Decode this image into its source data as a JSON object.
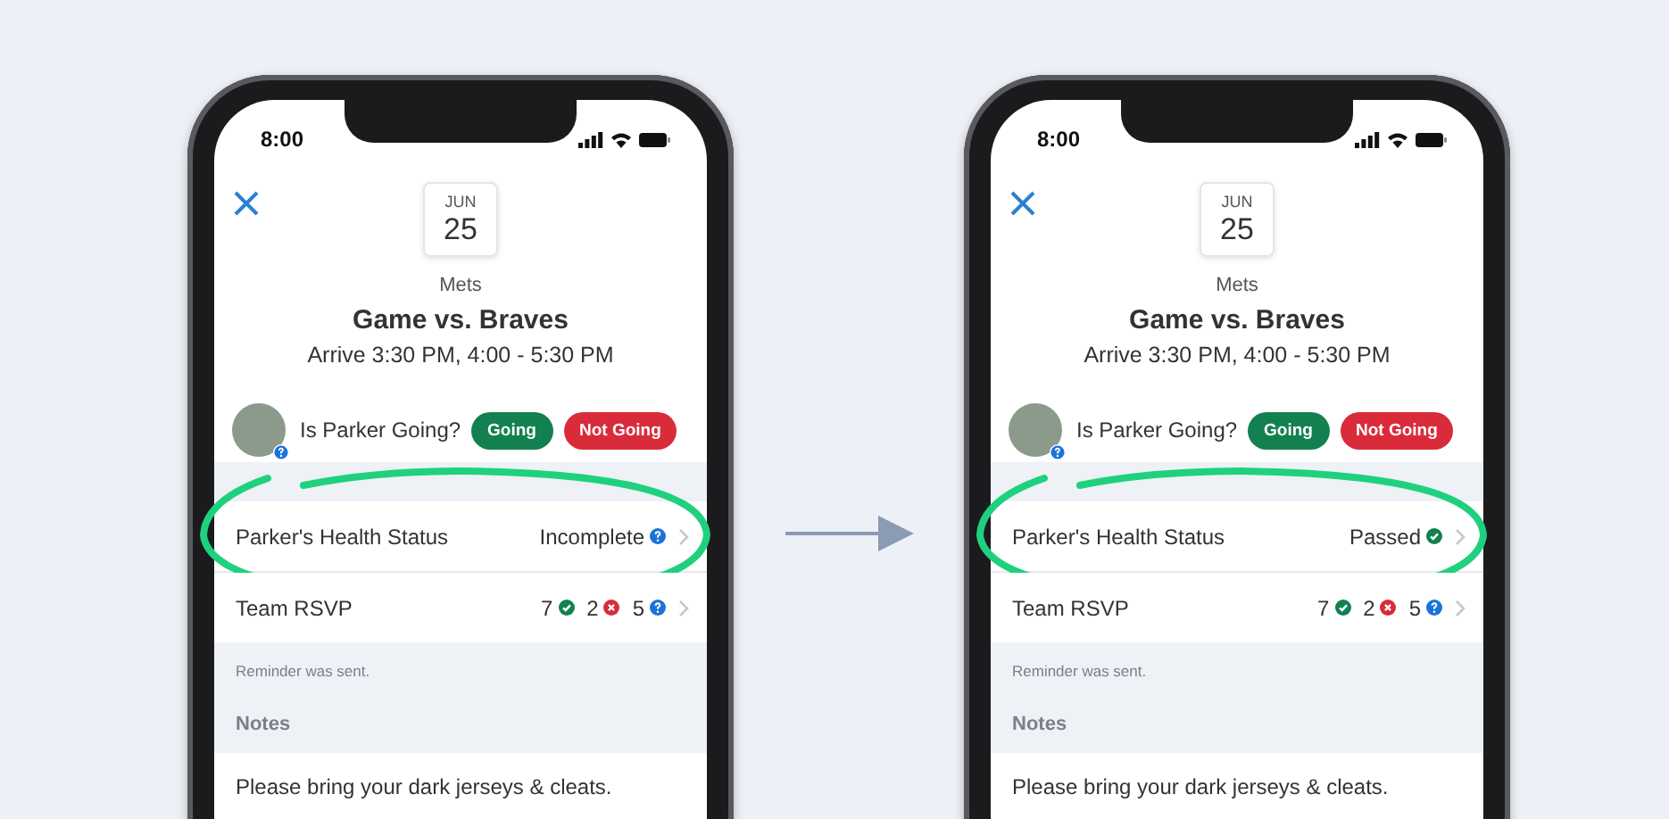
{
  "phones": [
    {
      "status_time": "8:00",
      "date": {
        "month": "JUN",
        "day": "25"
      },
      "team": "Mets",
      "title": "Game vs. Braves",
      "time": "Arrive 3:30 PM, 4:00 - 5:30 PM",
      "question": "Is Parker Going?",
      "buttons": [
        {
          "label": "Going",
          "kind": "going"
        },
        {
          "label": "Not Going",
          "kind": "not_going"
        }
      ],
      "health": {
        "label": "Parker's Health Status",
        "value": "Incomplete",
        "kind": "incomplete"
      },
      "rsvp": {
        "label": "Team RSVP",
        "counts": [
          {
            "value": "7",
            "kind": "yes"
          },
          {
            "value": "2",
            "kind": "no"
          },
          {
            "value": "5",
            "kind": "unknown"
          }
        ]
      },
      "reminder": "Reminder was sent.",
      "notes_heading": "Notes",
      "notes": "Please bring your dark jerseys & cleats."
    },
    {
      "status_time": "8:00",
      "date": {
        "month": "JUN",
        "day": "25"
      },
      "team": "Mets",
      "title": "Game vs. Braves",
      "time": "Arrive 3:30 PM, 4:00 - 5:30 PM",
      "question": "Is Parker Going?",
      "buttons": [
        {
          "label": "Going",
          "kind": "going"
        },
        {
          "label": "Not Going",
          "kind": "not_going"
        }
      ],
      "health": {
        "label": "Parker's Health Status",
        "value": "Passed",
        "kind": "passed"
      },
      "rsvp": {
        "label": "Team RSVP",
        "counts": [
          {
            "value": "7",
            "kind": "yes"
          },
          {
            "value": "2",
            "kind": "no"
          },
          {
            "value": "5",
            "kind": "unknown"
          }
        ]
      },
      "reminder": "Reminder was sent.",
      "notes_heading": "Notes",
      "notes": "Please bring your dark jerseys & cleats."
    }
  ]
}
